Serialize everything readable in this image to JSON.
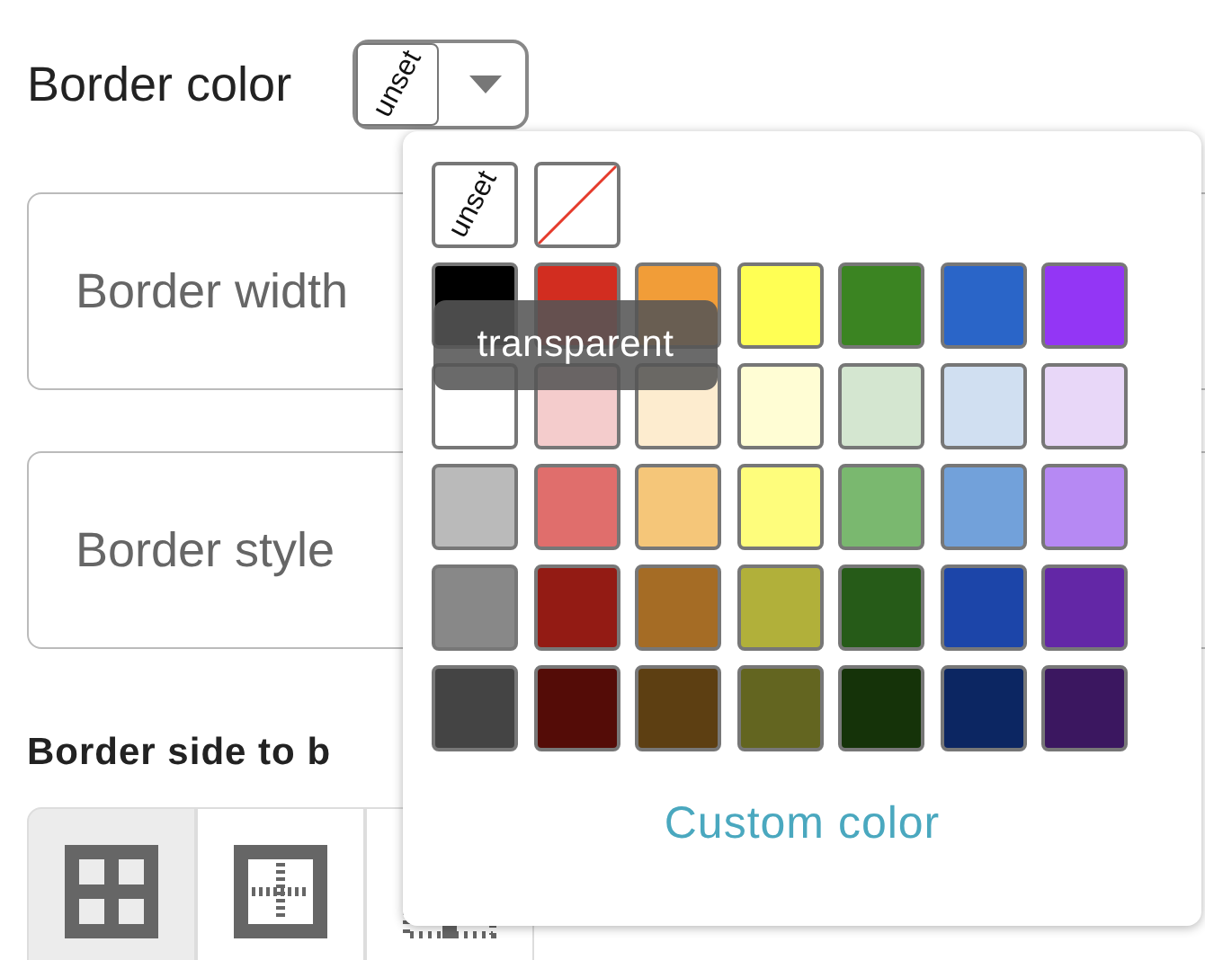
{
  "border_color": {
    "label": "Border color",
    "current": {
      "kind": "unset",
      "label": "unset"
    }
  },
  "fields": [
    {
      "placeholder": "Border width"
    },
    {
      "placeholder": "Border style"
    }
  ],
  "side_heading": "Border side to b",
  "side_buttons": [
    {
      "kind": "all",
      "selected": true
    },
    {
      "kind": "outer",
      "selected": false
    },
    {
      "kind": "inner",
      "selected": false
    }
  ],
  "palette": {
    "special": [
      {
        "kind": "unset",
        "label": "unset"
      },
      {
        "kind": "transparent"
      }
    ],
    "rows": [
      {
        "swatches": [
          {
            "color": "#000000"
          },
          {
            "color": "#d22d20"
          },
          {
            "color": "#f19d38"
          },
          {
            "color": "#ffff54"
          },
          {
            "color": "#3b8422"
          },
          {
            "color": "#2a65c8"
          },
          {
            "color": "#9336f5"
          }
        ]
      },
      {
        "swatches": [
          {
            "color": "#ffffff"
          },
          {
            "color": "#f4cccc"
          },
          {
            "color": "#fdeccf"
          },
          {
            "color": "#fffdd4"
          },
          {
            "color": "#d4e6d0"
          },
          {
            "color": "#d0dff1"
          },
          {
            "color": "#e8d7f8"
          }
        ]
      },
      {
        "swatches": [
          {
            "color": "#bababa"
          },
          {
            "color": "#e06e6c"
          },
          {
            "color": "#f5c679"
          },
          {
            "color": "#fefd7c"
          },
          {
            "color": "#7ab86f"
          },
          {
            "color": "#72a1da"
          },
          {
            "color": "#b689f3"
          }
        ]
      },
      {
        "swatches": [
          {
            "color": "#888888"
          },
          {
            "color": "#931b14"
          },
          {
            "color": "#a56c25"
          },
          {
            "color": "#b1b03a"
          },
          {
            "color": "#265b18"
          },
          {
            "color": "#1c45a9"
          },
          {
            "color": "#6327a6"
          }
        ]
      },
      {
        "swatches": [
          {
            "color": "#444444"
          },
          {
            "color": "#540c07"
          },
          {
            "color": "#5d3f12"
          },
          {
            "color": "#636520"
          },
          {
            "color": "#153309"
          },
          {
            "color": "#0c2662"
          },
          {
            "color": "#3b1760"
          }
        ]
      }
    ],
    "tooltip": "transparent",
    "custom_link": "Custom color"
  }
}
